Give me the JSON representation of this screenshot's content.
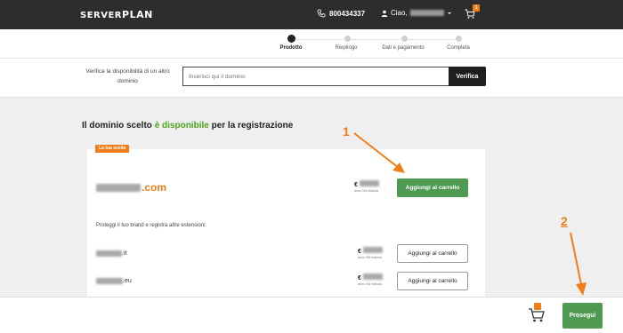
{
  "header": {
    "logo_left": "SERVER",
    "logo_right": "PLAN",
    "phone": "800434337",
    "greeting": "Ciao,",
    "cart_count": "1",
    "icons": [
      "phone-icon",
      "user-icon",
      "chevron-down-icon",
      "cart-icon"
    ]
  },
  "stepper": {
    "steps": [
      {
        "label": "Prodotto",
        "active": true
      },
      {
        "label": "Riepilogo",
        "active": false
      },
      {
        "label": "Dati e pagamento",
        "active": false
      },
      {
        "label": "Completa",
        "active": false
      }
    ]
  },
  "search": {
    "label": "Verifica la disponibilità di un altro dominio",
    "placeholder": "Inserisci qui il dominio",
    "button": "Verifica"
  },
  "result": {
    "heading_pre": "Il dominio scelto",
    "heading_status": "è disponibile",
    "heading_post": "per la registrazione",
    "badge": "La tua scelta",
    "domain_ext": ".com",
    "currency": "€",
    "vat_note_main": "anno IVA esclusa",
    "add_main": "Aggiungi al carrello",
    "protect_text": "Proteggi il tuo brand e registra altre estensioni:",
    "extensions": [
      {
        "ext": ".it",
        "currency": "€",
        "note": "anno IVA esclusa",
        "button": "Aggiungi al carrello"
      },
      {
        "ext": ".eu",
        "currency": "€",
        "note": "anno IVA esclusa",
        "button": "Aggiungi al carrello"
      }
    ]
  },
  "annotations": {
    "one": "1",
    "two": "2",
    "accent": "#f07d1a"
  },
  "footer": {
    "continue": "Prosegui"
  },
  "colors": {
    "topbar": "#2d2d2d",
    "brand_orange": "#f07d1a",
    "green_button": "#4f9a52",
    "available_green": "#4da31c"
  }
}
